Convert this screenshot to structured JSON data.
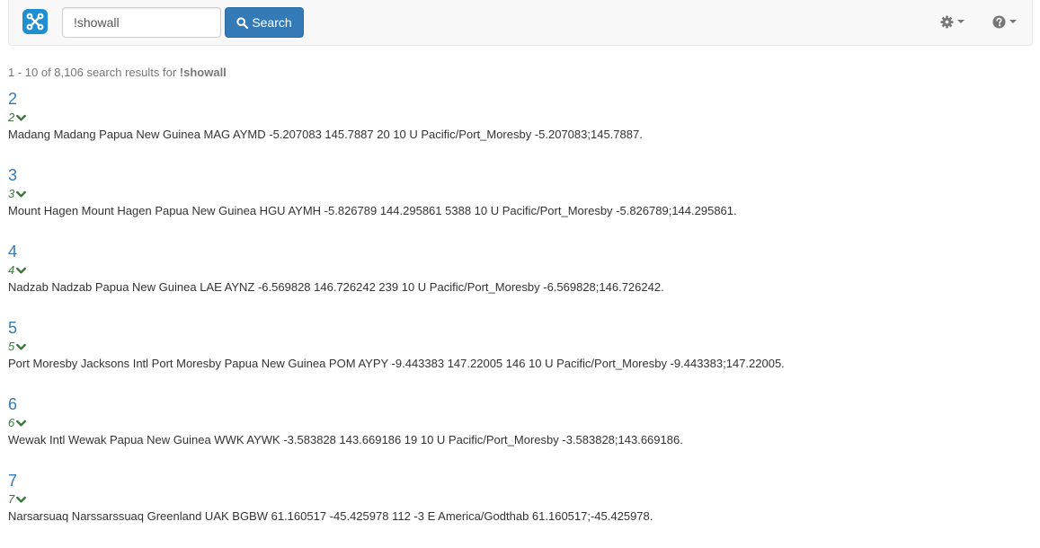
{
  "search": {
    "query": "!showall",
    "button_label": "Search"
  },
  "summary": {
    "range": "1 - 10 of 8,106 search results for ",
    "query": "!showall"
  },
  "results": [
    {
      "title": "2",
      "sub": "2",
      "text": "Madang Madang Papua New Guinea MAG AYMD -5.207083 145.7887 20 10 U Pacific/Port_Moresby -5.207083;145.7887."
    },
    {
      "title": "3",
      "sub": "3",
      "text": "Mount Hagen Mount Hagen Papua New Guinea HGU AYMH -5.826789 144.295861 5388 10 U Pacific/Port_Moresby -5.826789;144.295861."
    },
    {
      "title": "4",
      "sub": "4",
      "text": "Nadzab Nadzab Papua New Guinea LAE AYNZ -6.569828 146.726242 239 10 U Pacific/Port_Moresby -6.569828;146.726242."
    },
    {
      "title": "5",
      "sub": "5",
      "text": "Port Moresby Jacksons Intl Port Moresby Papua New Guinea POM AYPY -9.443383 147.22005 146 10 U Pacific/Port_Moresby -9.443383;147.22005."
    },
    {
      "title": "6",
      "sub": "6",
      "text": "Wewak Intl Wewak Papua New Guinea WWK AYWK -3.583828 143.669186 19 10 U Pacific/Port_Moresby -3.583828;143.669186."
    },
    {
      "title": "7",
      "sub": "7",
      "text": "Narsarsuaq Narssarssuaq Greenland UAK BGBW 61.160517 -45.425978 112 -3 E America/Godthab 61.160517;-45.425978."
    }
  ],
  "colors": {
    "brand": "#1f8fd1",
    "primary": "#337ab7",
    "link": "#337ab7",
    "sub": "#3c763d"
  },
  "icons": {
    "logo": "app-logo",
    "search": "magnifier-icon",
    "settings": "gear-icon",
    "help": "question-circle-icon",
    "expand": "chevron-down-icon"
  }
}
